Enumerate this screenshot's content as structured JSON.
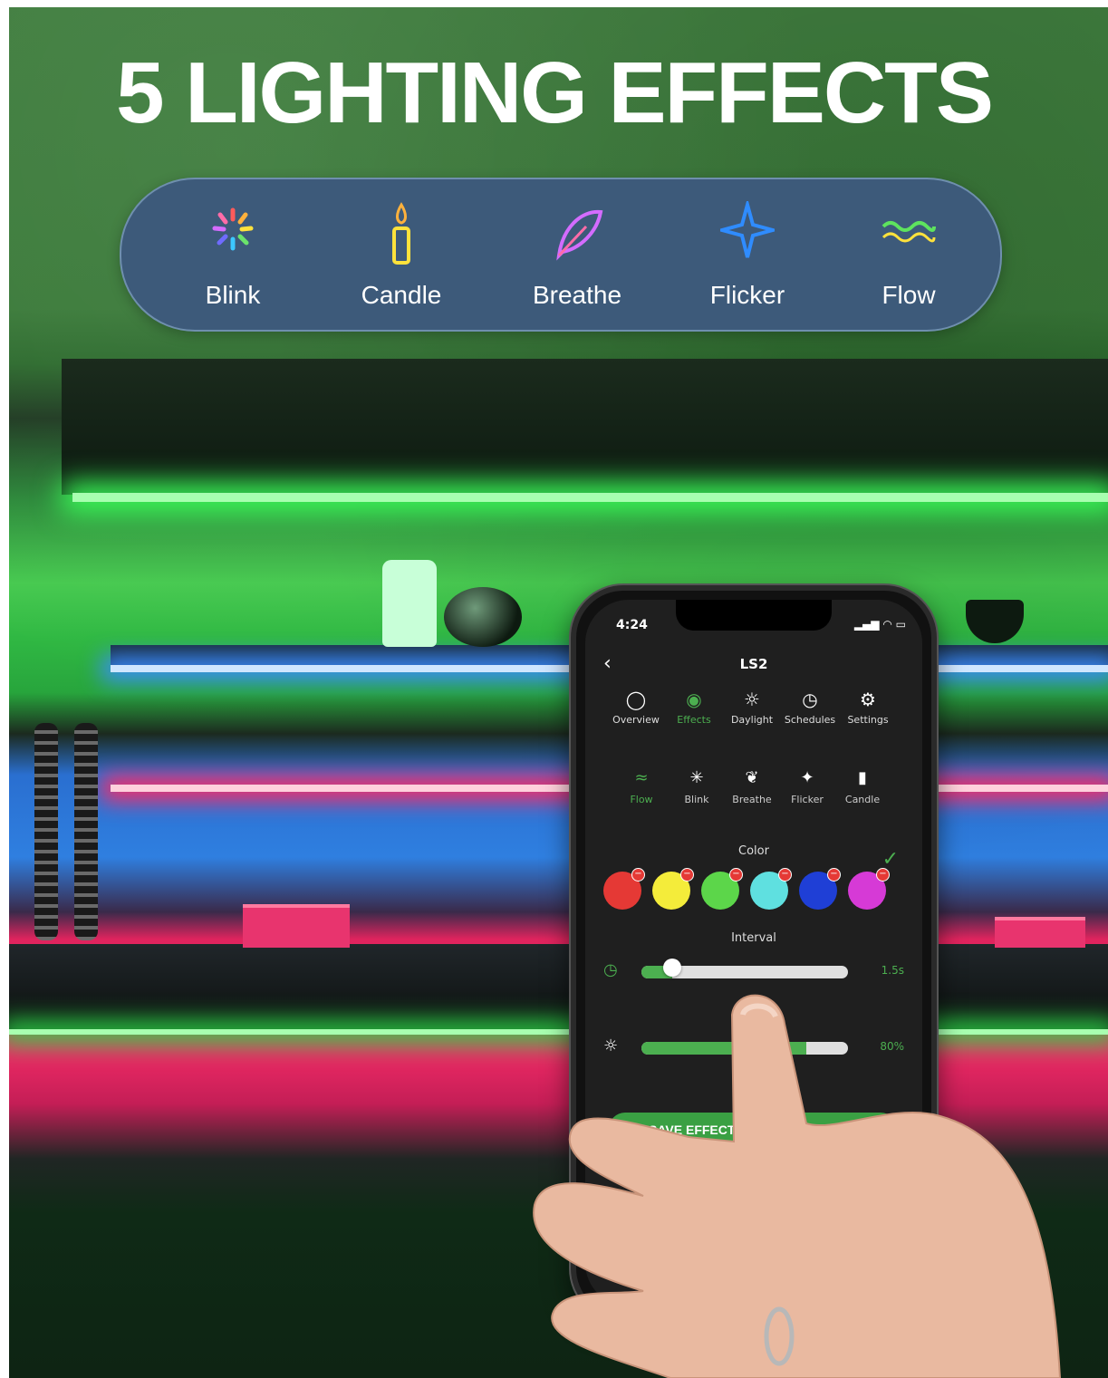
{
  "headline": "5 LIGHTING EFFECTS",
  "effects_banner": [
    {
      "label": "Blink",
      "icon": "blink-icon",
      "color": "#ff9a3c"
    },
    {
      "label": "Candle",
      "icon": "candle-icon",
      "color": "#ffe23c"
    },
    {
      "label": "Breathe",
      "icon": "feather-icon",
      "color": "#d46cff"
    },
    {
      "label": "Flicker",
      "icon": "star-icon",
      "color": "#2f8cff"
    },
    {
      "label": "Flow",
      "icon": "wave-icon",
      "color": "#5ee35e"
    }
  ],
  "phone": {
    "status_time": "4:24",
    "title": "LS2",
    "tabs": [
      {
        "label": "Overview",
        "icon": "bulb-icon"
      },
      {
        "label": "Effects",
        "icon": "palette-icon",
        "active": true
      },
      {
        "label": "Daylight",
        "icon": "sun-icon"
      },
      {
        "label": "Schedules",
        "icon": "alarm-icon"
      },
      {
        "label": "Settings",
        "icon": "gear-icon"
      }
    ],
    "effect_list": [
      {
        "label": "Flow",
        "active": true
      },
      {
        "label": "Blink"
      },
      {
        "label": "Breathe"
      },
      {
        "label": "Flicker"
      },
      {
        "label": "Candle"
      }
    ],
    "color_label": "Color",
    "colors": [
      "#e53935",
      "#f4ec3a",
      "#5cd64a",
      "#5fe0e0",
      "#1f3fd6",
      "#d63ad6"
    ],
    "interval_label": "Interval",
    "interval_value": "1.5s",
    "interval_fraction": 0.15,
    "brightness_label": "Br",
    "brightness_value": "80%",
    "brightness_fraction": 0.8,
    "save_label": "SAVE EFFECT INTO",
    "accent": "#4caf50"
  }
}
